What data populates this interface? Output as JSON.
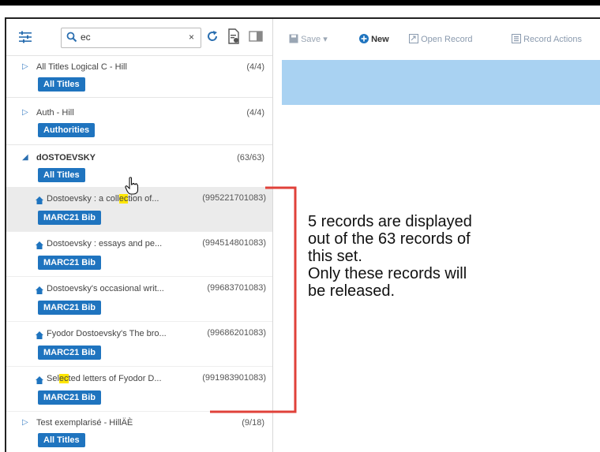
{
  "sidebar": {
    "search": {
      "value": "ec",
      "clear": "×"
    },
    "sets": [
      {
        "name": "All Titles Logical C - Hill",
        "count": "(4/4)",
        "badge": "All Titles"
      },
      {
        "name": "Auth - Hill",
        "count": "(4/4)",
        "badge": "Authorities"
      },
      {
        "name": "dOSTOEVSKY",
        "count": "(63/63)",
        "badge": "All Titles"
      },
      {
        "name": "Test exemplarisé - HillÄÈ",
        "count": "(9/18)",
        "badge": "All Titles"
      }
    ],
    "records": [
      {
        "title_pre": "Dostoevsky : a coll",
        "title_hl": "ec",
        "title_post": "tion of...",
        "mms": "(995221701083)",
        "badge": "MARC21 Bib"
      },
      {
        "title_pre": "Dostoevsky : essays and pe...",
        "title_hl": "",
        "title_post": "",
        "mms": "(994514801083)",
        "badge": "MARC21 Bib"
      },
      {
        "title_pre": "Dostoevsky's occasional writ...",
        "title_hl": "",
        "title_post": "",
        "mms": "(99683701083)",
        "badge": "MARC21 Bib"
      },
      {
        "title_pre": "Fyodor Dostoevsky's The bro...",
        "title_hl": "",
        "title_post": "",
        "mms": "(99686201083)",
        "badge": "MARC21 Bib"
      },
      {
        "title_pre": "Sel",
        "title_hl": "ec",
        "title_post": "ted letters of Fyodor D...",
        "mms": "(991983901083)",
        "badge": "MARC21 Bib"
      }
    ]
  },
  "toolbar": {
    "save": "Save",
    "new": "New",
    "open_record": "Open Record",
    "record_actions": "Record Actions"
  },
  "annotation": {
    "lines": [
      "5 records are displayed",
      "out of the 63 records of",
      "this set.",
      "Only these records will",
      "be released."
    ]
  },
  "colors": {
    "accent": "#1f74bf",
    "highlight": "#ffe600",
    "annotation_bracket": "#e0413a",
    "editor_band": "#a9d2f2"
  }
}
